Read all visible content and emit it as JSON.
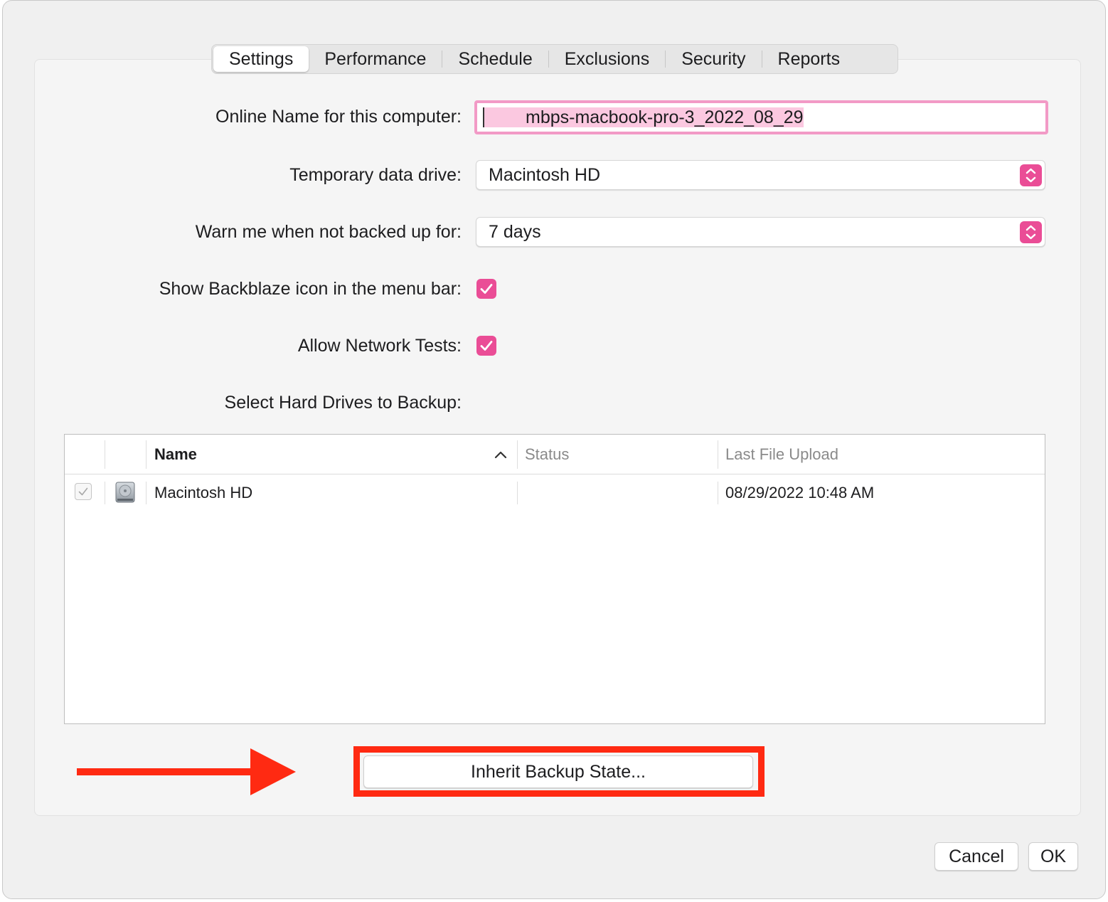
{
  "tabs": [
    {
      "label": "Settings",
      "active": true
    },
    {
      "label": "Performance",
      "active": false
    },
    {
      "label": "Schedule",
      "active": false
    },
    {
      "label": "Exclusions",
      "active": false
    },
    {
      "label": "Security",
      "active": false
    },
    {
      "label": "Reports",
      "active": false
    }
  ],
  "settings": {
    "online_name_label": "Online Name for this computer:",
    "online_name_value": "mbps-macbook-pro-3_2022_08_29",
    "temp_drive_label": "Temporary data drive:",
    "temp_drive_value": "Macintosh HD",
    "warn_label": "Warn me when not backed up for:",
    "warn_value": "7 days",
    "show_icon_label": "Show Backblaze icon in the menu bar:",
    "show_icon_checked": true,
    "network_tests_label": "Allow Network Tests:",
    "network_tests_checked": true,
    "drives_label": "Select Hard Drives to Backup:"
  },
  "drives_table": {
    "columns": [
      "Name",
      "Status",
      "Last File Upload"
    ],
    "sort_column": "Name",
    "sort_direction": "ascending",
    "rows": [
      {
        "checked": true,
        "icon": "hard-drive-icon",
        "name": "Macintosh HD",
        "status": "",
        "last_upload": "08/29/2022 10:48 AM"
      }
    ]
  },
  "buttons": {
    "inherit": "Inherit Backup State...",
    "cancel": "Cancel",
    "ok": "OK"
  },
  "colors": {
    "accent": "#ea4d96",
    "annotation": "#ff2a12"
  }
}
